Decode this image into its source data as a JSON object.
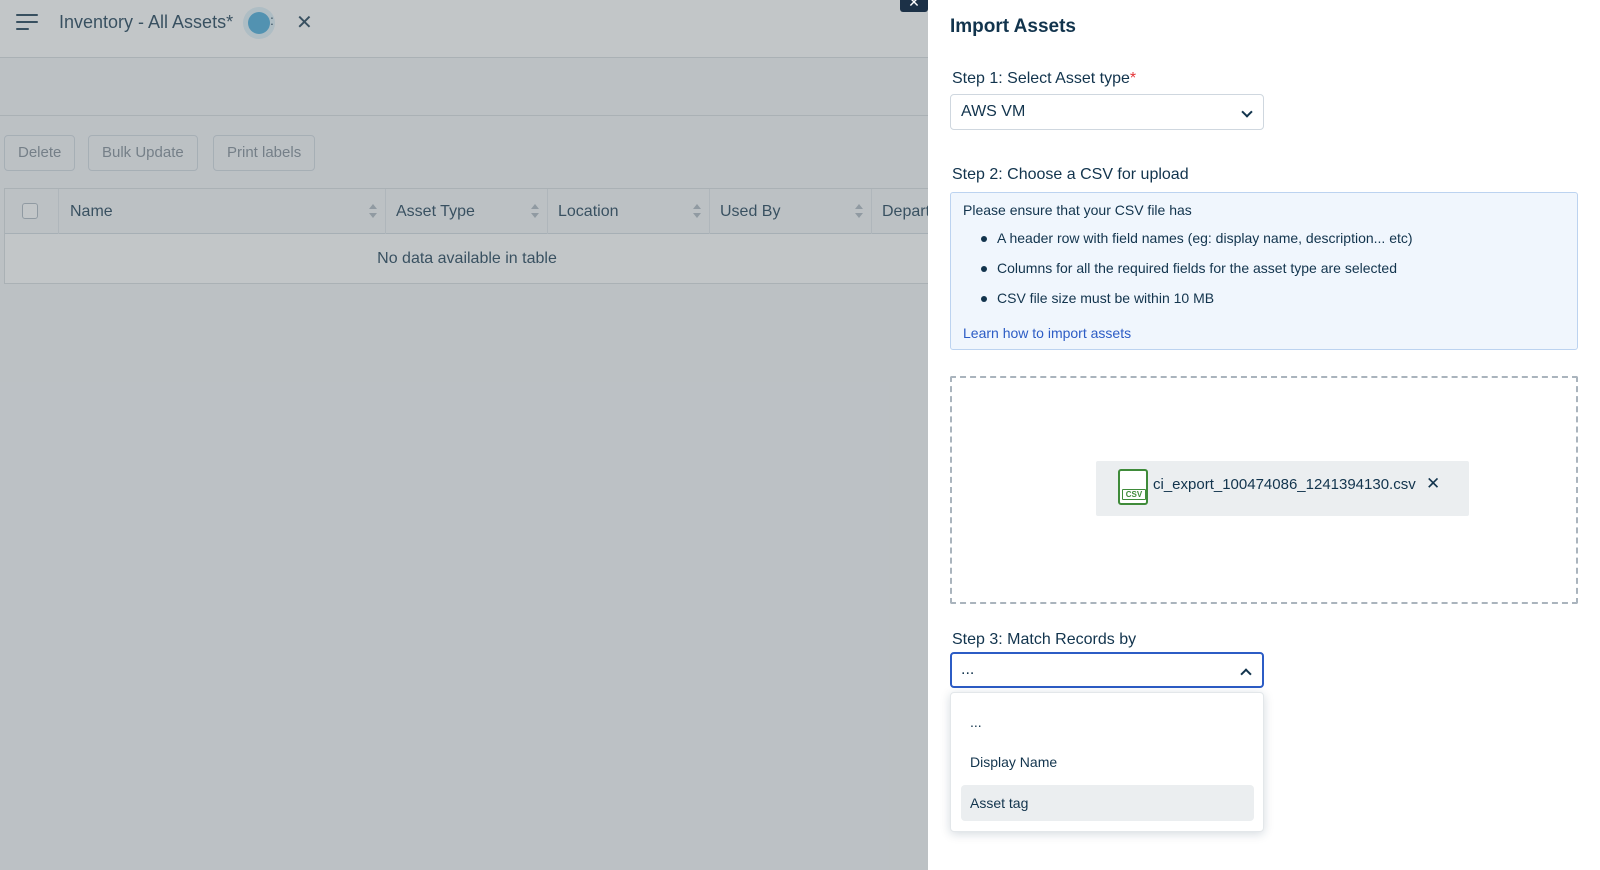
{
  "app": {
    "title": "Inventory - All Assets*",
    "status_tail": ":",
    "close_glyph": "✕"
  },
  "toolbar": {
    "delete_label": "Delete",
    "bulk_update_label": "Bulk Update",
    "print_labels_label": "Print labels"
  },
  "table": {
    "columns": [
      "Name",
      "Asset Type",
      "Location",
      "Used By",
      "Department"
    ],
    "empty_message": "No data available in table"
  },
  "drawer": {
    "close_glyph": "✕",
    "title": "Import Assets",
    "step1": {
      "label": "Step 1: Select Asset type",
      "required_mark": "*",
      "selected_value": "AWS VM"
    },
    "step2": {
      "label": "Step 2: Choose a CSV for upload",
      "intro": "Please ensure that your CSV file has",
      "requirements": [
        "A header row with field names (eg: display name, description... etc)",
        "Columns for all the required fields for the asset type are selected",
        "CSV file size must be within 10 MB"
      ],
      "help_link": "Learn how to import assets",
      "file": {
        "icon_text": "CSV",
        "name": "ci_export_100474086_1241394130.csv",
        "remove_glyph": "✕"
      }
    },
    "step3": {
      "label": "Step 3: Match Records by",
      "selected_value": "...",
      "options": [
        "...",
        "Display Name",
        "Asset tag"
      ],
      "hovered_option": "Asset tag"
    }
  },
  "colors": {
    "primary_text": "#12344d",
    "link": "#2c5cc5",
    "required": "#e43538",
    "focus_border": "#2c5cc5",
    "status_dot": "#3ea6d8",
    "csv_icon": "#3f8b3a"
  }
}
